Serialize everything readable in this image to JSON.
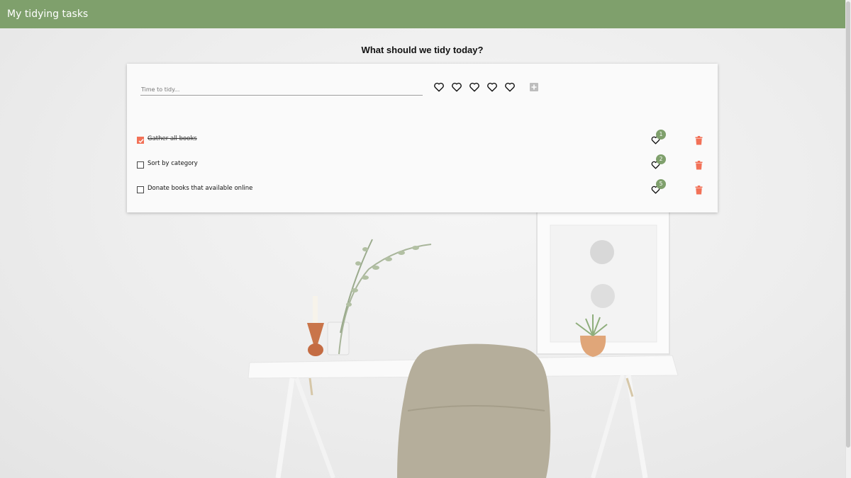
{
  "header": {
    "title": "My tidying tasks"
  },
  "main": {
    "heading": "What should we tidy today?"
  },
  "new_task": {
    "placeholder": "Time to tidy...",
    "value": "",
    "rating_icons": [
      "heart-icon",
      "heart-icon",
      "heart-icon",
      "heart-icon",
      "heart-icon"
    ],
    "add_icon": "plus-square-icon"
  },
  "tasks": [
    {
      "label": "Gather all books",
      "done": true,
      "likes": "1"
    },
    {
      "label": "Sort by category",
      "done": false,
      "likes": "2"
    },
    {
      "label": "Donate books that available online",
      "done": false,
      "likes": "5"
    }
  ],
  "colors": {
    "appbar": "#7fa06c",
    "accent": "#f27157",
    "badge": "#7fa06c",
    "card": "#fafafa"
  }
}
